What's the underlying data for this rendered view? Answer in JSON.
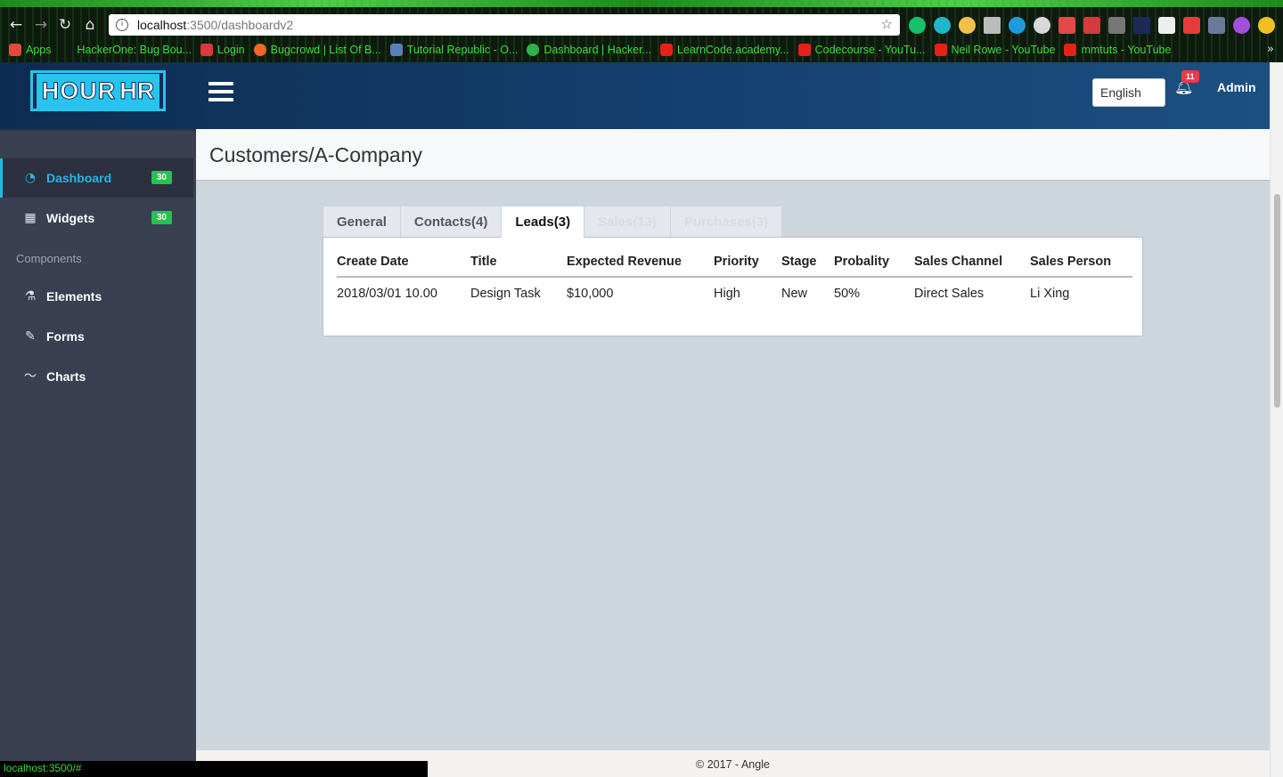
{
  "browser": {
    "url_host": "localhost",
    "url_path": ":3500/dashboardv2",
    "status_url": "localhost:3500/#",
    "bookmarks": [
      {
        "label": "Apps",
        "color": "#e04a3a"
      },
      {
        "label": "HackerOne: Bug Bou...",
        "color": "#222222"
      },
      {
        "label": "Login",
        "color": "#d93a3a"
      },
      {
        "label": "Bugcrowd | List Of B...",
        "color": "#f26822"
      },
      {
        "label": "Tutorial Republic - O...",
        "color": "#5a7fbf"
      },
      {
        "label": "Dashboard | Hacker...",
        "color": "#2bb24c"
      },
      {
        "label": "LearnCode.academy...",
        "color": "#e62117"
      },
      {
        "label": "Codecourse - YouTu...",
        "color": "#e62117"
      },
      {
        "label": "Neil Rowe - YouTube",
        "color": "#e62117"
      },
      {
        "label": "mmtuts - YouTube",
        "color": "#e62117"
      }
    ]
  },
  "header": {
    "logo_hour": "HOUR",
    "logo_hr": "HR",
    "language": "English",
    "notification_count": "11",
    "user": "Admin"
  },
  "sidebar": {
    "items": [
      {
        "label": "Dashboard",
        "badge": "30",
        "icon": "gauge-icon"
      },
      {
        "label": "Widgets",
        "badge": "30",
        "icon": "grid-icon"
      }
    ],
    "heading": "Components",
    "components": [
      {
        "label": "Elements",
        "icon": "flask-icon"
      },
      {
        "label": "Forms",
        "icon": "edit-icon"
      },
      {
        "label": "Charts",
        "icon": "trend-icon"
      }
    ]
  },
  "main": {
    "title": "Customers/A-Company",
    "tabs": [
      {
        "label": "General"
      },
      {
        "label": "Contacts(4)"
      },
      {
        "label": "Leads(3)"
      },
      {
        "label": "Sales(13)"
      },
      {
        "label": "Purchases(3)"
      }
    ],
    "table": {
      "headers": [
        "Create Date",
        "Title",
        "Expected Revenue",
        "Priority",
        "Stage",
        "Probality",
        "Sales Channel",
        "Sales Person"
      ],
      "rows": [
        [
          "2018/03/01 10.00",
          "Design Task",
          "$10,000",
          "High",
          "New",
          "50%",
          "Direct Sales",
          "Li Xing"
        ]
      ]
    }
  },
  "footer": {
    "text": "© 2017 - Angle"
  },
  "colors": {
    "accent": "#23b7e5",
    "badge_green": "#27c24c",
    "header_dark": "#0e2c52",
    "sidebar_bg": "#3a3f51"
  }
}
